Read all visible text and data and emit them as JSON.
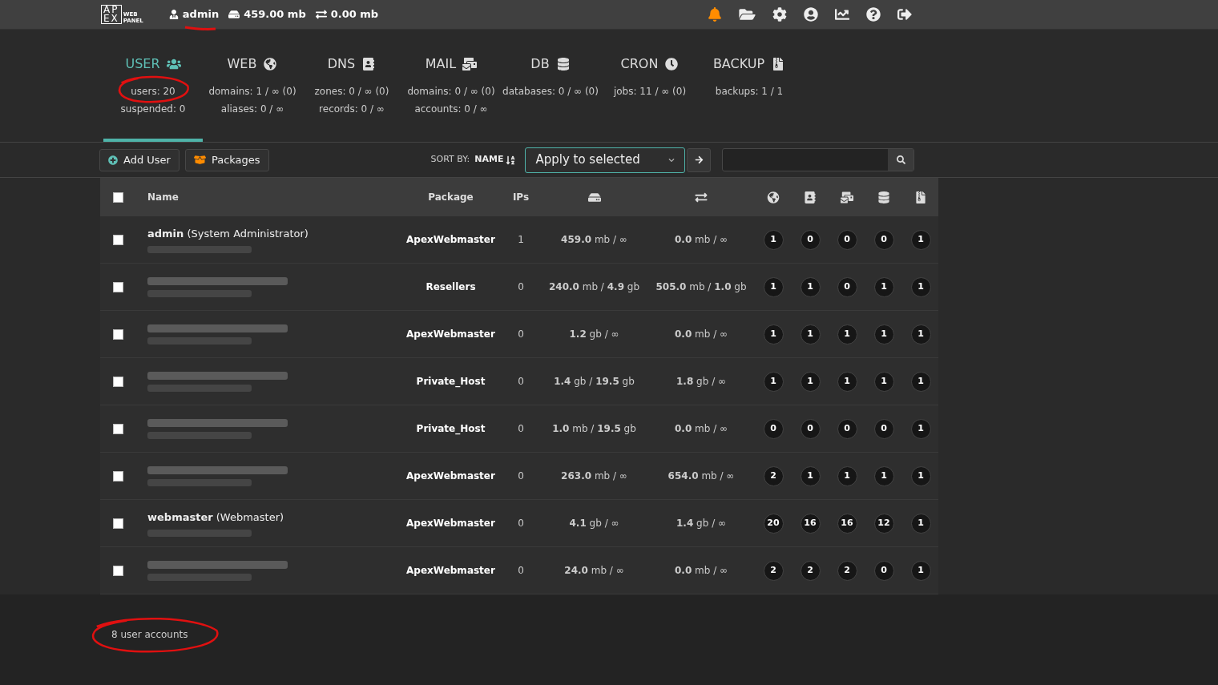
{
  "topbar": {
    "logo": {
      "top": "AP",
      "bottom": "EX",
      "side_top": "WEB",
      "side_bottom": "PANEL"
    },
    "user": {
      "name": "admin",
      "underlined": true
    },
    "disk": "459.00 mb",
    "bandwidth": "0.00 mb",
    "notifications": {
      "alert": true
    }
  },
  "tabs": [
    {
      "kind": "user",
      "label": "USER",
      "selected": true,
      "lines": [
        "users: 20",
        "suspended: 0"
      ],
      "circled": true
    },
    {
      "kind": "web",
      "label": "WEB",
      "selected": false,
      "lines": [
        "domains: 1 / ∞ (0)",
        "aliases: 0 / ∞"
      ],
      "circled": false
    },
    {
      "kind": "dns",
      "label": "DNS",
      "selected": false,
      "lines": [
        "zones: 0 / ∞ (0)",
        "records: 0 / ∞"
      ],
      "circled": false
    },
    {
      "kind": "mail",
      "label": "MAIL",
      "selected": false,
      "lines": [
        "domains: 0 / ∞ (0)",
        "accounts: 0 / ∞"
      ],
      "circled": false
    },
    {
      "kind": "db",
      "label": "DB",
      "selected": false,
      "lines": [
        "databases: 0 / ∞ (0)"
      ],
      "circled": false
    },
    {
      "kind": "cron",
      "label": "CRON",
      "selected": false,
      "lines": [
        "jobs: 11 / ∞ (0)"
      ],
      "circled": false
    },
    {
      "kind": "backup",
      "label": "BACKUP",
      "selected": false,
      "lines": [
        "backups: 1 / 1"
      ],
      "circled": false
    }
  ],
  "toolbar": {
    "add_button": "Add User",
    "packages_button": "Packages",
    "sort_label": "SORT BY:",
    "sort_value": "NAME",
    "bulk_select": "Apply to selected"
  },
  "table": {
    "columns": [
      {
        "kind": "check",
        "checked": false
      },
      {
        "kind": "text",
        "label": "Name"
      },
      {
        "kind": "text",
        "label": "Package"
      },
      {
        "kind": "text",
        "label": "IPs"
      },
      {
        "kind": "icon"
      },
      {
        "kind": "icon"
      },
      {
        "kind": "icon"
      },
      {
        "kind": "icon"
      },
      {
        "kind": "icon"
      },
      {
        "kind": "icon"
      },
      {
        "kind": "icon"
      }
    ],
    "rows": [
      {
        "checked": false,
        "blurred": false,
        "name": "**admin** (System Administrator)",
        "package": "ApexWebmaster",
        "ips": "1",
        "disk": "**459.0** mb / ∞",
        "bandwidth": "**0.0** mb / ∞",
        "counts": [
          "1",
          "0",
          "0",
          "0",
          "1"
        ]
      },
      {
        "checked": false,
        "blurred": true,
        "package": "Resellers",
        "ips": "0",
        "disk": "**240.0** mb / **4.9** gb",
        "bandwidth": "**505.0** mb / **1.0** gb",
        "counts": [
          "1",
          "1",
          "0",
          "1",
          "1"
        ]
      },
      {
        "checked": false,
        "blurred": true,
        "package": "ApexWebmaster",
        "ips": "0",
        "disk": "**1.2** gb / ∞",
        "bandwidth": "**0.0** mb / ∞",
        "counts": [
          "1",
          "1",
          "1",
          "1",
          "1"
        ]
      },
      {
        "checked": false,
        "blurred": true,
        "package": "Private_Host",
        "ips": "0",
        "disk": "**1.4** gb / **19.5** gb",
        "bandwidth": "**1.8** gb / ∞",
        "counts": [
          "1",
          "1",
          "1",
          "1",
          "1"
        ]
      },
      {
        "checked": false,
        "blurred": true,
        "package": "Private_Host",
        "ips": "0",
        "disk": "**1.0** mb / **19.5** gb",
        "bandwidth": "**0.0** mb / ∞",
        "counts": [
          "0",
          "0",
          "0",
          "0",
          "1"
        ]
      },
      {
        "checked": false,
        "blurred": true,
        "package": "ApexWebmaster",
        "ips": "0",
        "disk": "**263.0** mb / ∞",
        "bandwidth": "**654.0** mb / ∞",
        "counts": [
          "2",
          "1",
          "1",
          "1",
          "1"
        ]
      },
      {
        "checked": false,
        "blurred": false,
        "name": "**webmaster** (Webmaster)",
        "package": "ApexWebmaster",
        "ips": "0",
        "disk": "**4.1** gb / ∞",
        "bandwidth": "**1.4** gb / ∞",
        "counts": [
          "20",
          "16",
          "16",
          "12",
          "1"
        ]
      },
      {
        "checked": false,
        "blurred": true,
        "package": "ApexWebmaster",
        "ips": "0",
        "disk": "**24.0** mb / ∞",
        "bandwidth": "**0.0** mb / ∞",
        "counts": [
          "2",
          "2",
          "2",
          "0",
          "1"
        ]
      }
    ]
  },
  "footer": {
    "count": "8 user accounts",
    "circled": true
  }
}
